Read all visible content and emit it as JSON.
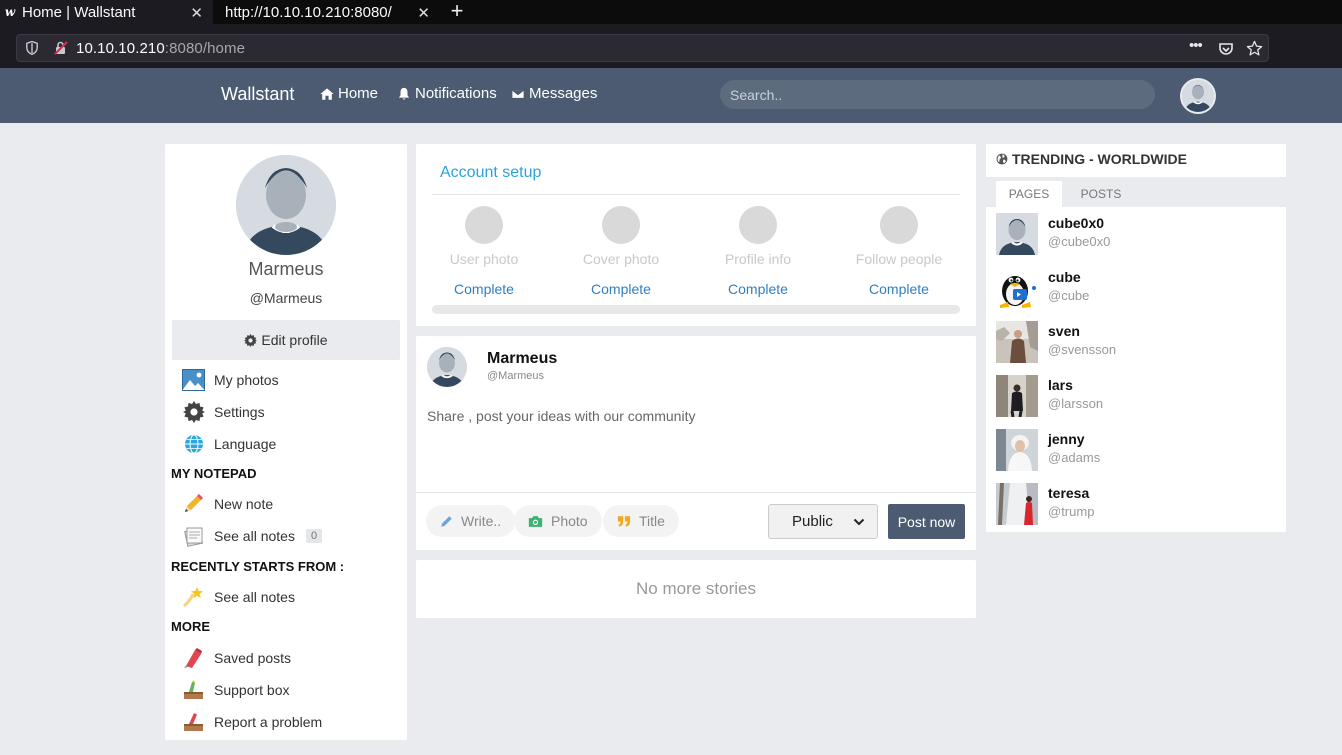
{
  "browser": {
    "tabs": [
      {
        "title": "Home | Wallstant",
        "favicon": "w"
      },
      {
        "title": "http://10.10.10.210:8080/"
      }
    ],
    "new_tab": "+",
    "close_glyph": "✕",
    "url_host": "10.10.10.210",
    "url_rest": ":8080/home",
    "menu_glyph": "•••"
  },
  "header": {
    "brand": "Wallstant",
    "nav": [
      {
        "label": "Home",
        "icon": "home-icon"
      },
      {
        "label": "Notifications",
        "icon": "bell-icon"
      },
      {
        "label": "Messages",
        "icon": "envelope-icon"
      }
    ],
    "search_placeholder": "Search.."
  },
  "profile": {
    "name": "Marmeus",
    "handle": "@Marmeus",
    "edit_label": "Edit profile"
  },
  "sidebar": {
    "menu": [
      {
        "label": "My photos",
        "icon": "photos-icon"
      },
      {
        "label": "Settings",
        "icon": "gear-icon"
      },
      {
        "label": "Language",
        "icon": "globe-icon"
      }
    ],
    "notepad_heading": "MY NOTEPAD",
    "notepad": [
      {
        "label": "New note",
        "icon": "pencil-icon"
      },
      {
        "label": "See all notes",
        "icon": "notes-icon",
        "count": "0"
      }
    ],
    "recent_heading": "RECENTLY STARTS FROM :",
    "recent": [
      {
        "label": "See all notes",
        "icon": "shooting-star-icon"
      }
    ],
    "more_heading": "MORE",
    "more": [
      {
        "label": "Saved posts",
        "icon": "bookmark-icon"
      },
      {
        "label": "Support box",
        "icon": "support-icon"
      },
      {
        "label": "Report a problem",
        "icon": "report-icon"
      }
    ]
  },
  "account_setup": {
    "title": "Account setup",
    "steps": [
      {
        "label": "User photo",
        "action": "Complete"
      },
      {
        "label": "Cover photo",
        "action": "Complete"
      },
      {
        "label": "Profile info",
        "action": "Complete"
      },
      {
        "label": "Follow people",
        "action": "Complete"
      }
    ],
    "progress": 0
  },
  "composer": {
    "name": "Marmeus",
    "handle": "@Marmeus",
    "placeholder": "Share , post your ideas with our community",
    "write_label": "Write..",
    "photo_label": "Photo",
    "title_label": "Title",
    "privacy": "Public",
    "post_label": "Post now",
    "colors": {
      "write": "#6aa6e0",
      "photo": "#3cb371",
      "title": "#f0a81e"
    }
  },
  "feed": {
    "empty_text": "No more stories"
  },
  "trending": {
    "heading": "TRENDING - WORLDWIDE",
    "tabs": [
      "PAGES",
      "POSTS"
    ],
    "items": [
      {
        "name": "cube0x0",
        "handle": "@cube0x0",
        "pic": "default-avatar"
      },
      {
        "name": "cube",
        "handle": "@cube",
        "pic": "penguin-avatar"
      },
      {
        "name": "sven",
        "handle": "@svensson",
        "pic": "photo-avatar"
      },
      {
        "name": "lars",
        "handle": "@larsson",
        "pic": "photo-avatar"
      },
      {
        "name": "jenny",
        "handle": "@adams",
        "pic": "photo-avatar"
      },
      {
        "name": "teresa",
        "handle": "@trump",
        "pic": "photo-avatar"
      }
    ]
  },
  "colors": {
    "header_bg": "#4c5b71",
    "accent_blue": "#2f7fc1",
    "page_bg": "#e9ebee"
  }
}
